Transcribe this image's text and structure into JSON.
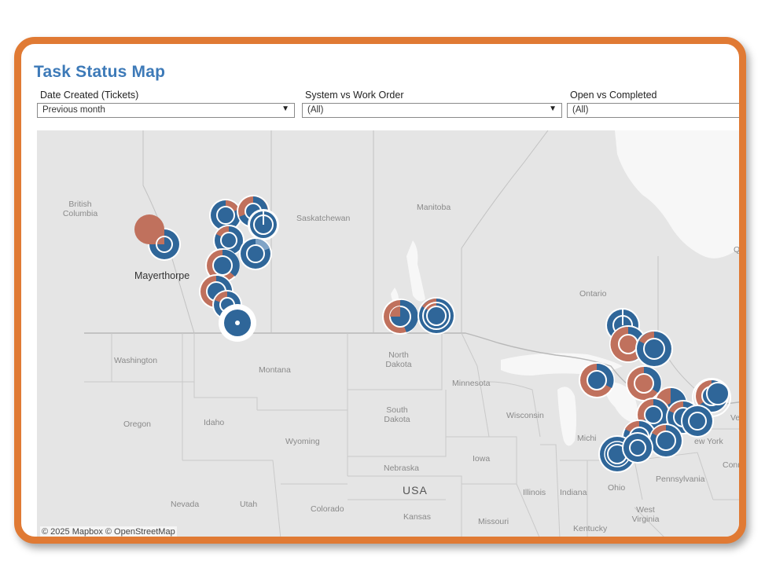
{
  "dashboard": {
    "title": "Task Status Map"
  },
  "filters": [
    {
      "label": "Date Created (Tickets)",
      "value": "Previous month"
    },
    {
      "label": "System vs Work Order",
      "value": "(All)"
    },
    {
      "label": "Open vs Completed",
      "value": "(All)"
    }
  ],
  "map": {
    "region_labels": {
      "british_columbia": "British Columbia",
      "saskatchewan": "Saskatchewan",
      "manitoba": "Manitoba",
      "ontario": "Ontario",
      "washington": "Washington",
      "montana": "Montana",
      "north_dakota": "North Dakota",
      "minnesota": "Minnesota",
      "oregon": "Oregon",
      "idaho": "Idaho",
      "wyoming": "Wyoming",
      "south_dakota": "South Dakota",
      "wisconsin": "Wisconsin",
      "iowa": "Iowa",
      "nebraska": "Nebraska",
      "illinois": "Illinois",
      "indiana": "Indiana",
      "ohio": "Ohio",
      "pennsylvania": "Pennsylvania",
      "nevada": "Nevada",
      "utah": "Utah",
      "colorado": "Colorado",
      "kansas": "Kansas",
      "missouri": "Missouri",
      "kentucky": "Kentucky",
      "west_virginia": "West Virginia",
      "michigan": "Michi",
      "new_york": "ew York",
      "quebec": "Qu",
      "vermont": "Ver",
      "connecticut": "Conn"
    },
    "city_label": "Mayerthorpe",
    "country_label": "USA",
    "attribution": "© 2025 Mapbox  © OpenStreetMap",
    "colors": {
      "completed": "#2f6699",
      "open": "#c0715d",
      "land": "#e5e5e5",
      "water": "#f7f7f7",
      "border": "#c2c2c2"
    }
  }
}
